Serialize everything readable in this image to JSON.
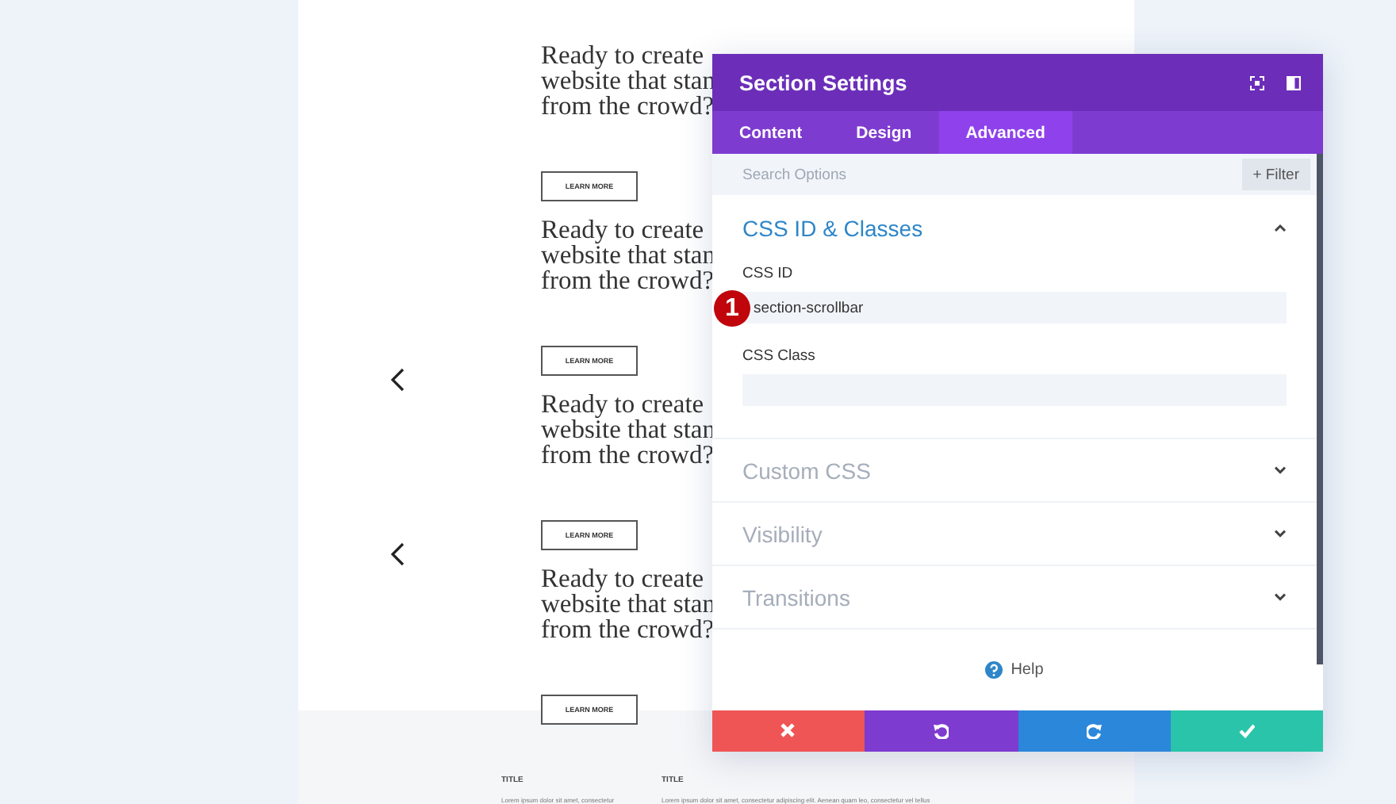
{
  "page": {
    "blocks": [
      {
        "heading_lines": [
          "Ready to create",
          "website that stan",
          "from the crowd?"
        ],
        "button": "LEARN MORE",
        "has_arrow": false
      },
      {
        "heading_lines": [
          "Ready to create",
          "website that stan",
          "from the crowd?"
        ],
        "button": "LEARN MORE",
        "has_arrow": true
      },
      {
        "heading_lines": [
          "Ready to create",
          "website that stan",
          "from the crowd?"
        ],
        "button": "LEARN MORE",
        "has_arrow": true
      },
      {
        "heading_lines": [
          "Ready to create",
          "website that stan",
          "from the crowd?"
        ],
        "button": "LEARN MORE",
        "has_arrow": false
      }
    ],
    "footer": {
      "columns": [
        {
          "title": "TITLE",
          "text": "Lorem ipsum dolor sit amet, consectetur"
        },
        {
          "title": "TITLE",
          "text": "Lorem ipsum dolor sit amet, consectetur adipiscing elit. Aenean quam leo, consectetur vel tellus"
        }
      ]
    }
  },
  "modal": {
    "title": "Section Settings",
    "tabs": [
      {
        "label": "Content",
        "selected": false
      },
      {
        "label": "Design",
        "selected": false
      },
      {
        "label": "Advanced",
        "selected": true
      }
    ],
    "search": {
      "placeholder": "Search Options",
      "filter": "+ Filter"
    },
    "sections": [
      {
        "title": "CSS ID & Classes",
        "expanded": true,
        "fields": [
          {
            "label": "CSS ID",
            "value": "section-scrollbar",
            "badge": "1"
          },
          {
            "label": "CSS Class"
          }
        ]
      },
      {
        "title": "Custom CSS",
        "expanded": false
      },
      {
        "title": "Visibility",
        "expanded": false
      },
      {
        "title": "Transitions",
        "expanded": false
      }
    ],
    "help": "Help",
    "actions": [
      {
        "kind": "cancel"
      },
      {
        "kind": "undo"
      },
      {
        "kind": "redo"
      },
      {
        "kind": "save"
      }
    ]
  }
}
